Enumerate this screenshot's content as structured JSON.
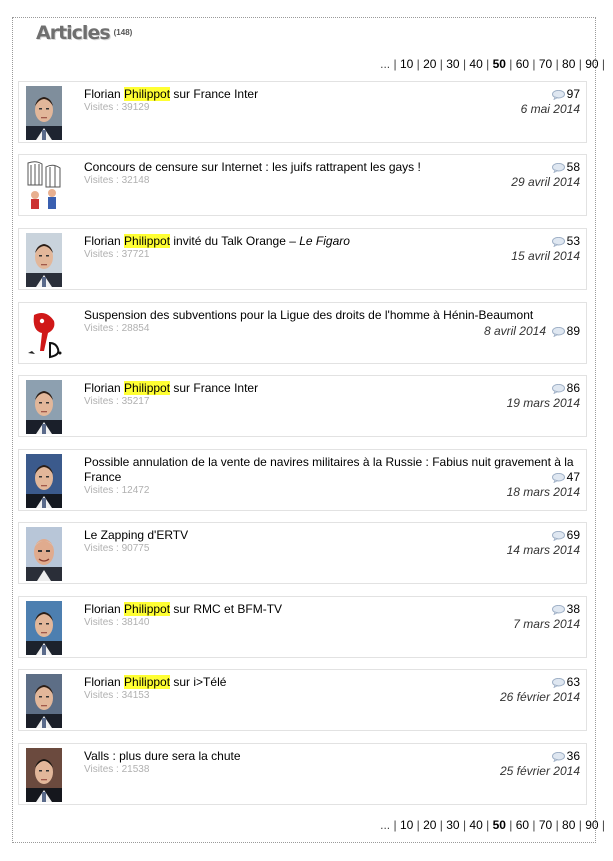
{
  "header": {
    "title": "Articles",
    "count": "(148)"
  },
  "pagination": {
    "prefix": "... |",
    "pages": [
      "10",
      "20",
      "30",
      "40",
      "50",
      "60",
      "70",
      "80",
      "90"
    ],
    "current": "50",
    "suffix": "|"
  },
  "articles": [
    {
      "pre": "Florian ",
      "hl": "Philippot",
      "post": " sur France Inter",
      "ital": "",
      "visits": "Visites : 39129",
      "comments": "97",
      "date": "6 mai 2014"
    },
    {
      "pre": "Concours de censure sur Internet : les juifs rattrapent les gays !",
      "hl": "",
      "post": "",
      "ital": "",
      "visits": "Visites : 32148",
      "comments": "58",
      "date": "29 avril 2014"
    },
    {
      "pre": "Florian ",
      "hl": "Philippot",
      "post": " invité du Talk Orange – ",
      "ital": "Le Figaro",
      "visits": "Visites : 37721",
      "comments": "53",
      "date": "15 avril 2014"
    },
    {
      "pre": "Suspension des subventions pour la Ligue des droits de l'homme à Hénin-Beaumont",
      "hl": "",
      "post": "",
      "ital": "",
      "visits": "Visites : 28854",
      "comments": "89",
      "date": "8 avril 2014"
    },
    {
      "pre": "Florian ",
      "hl": "Philippot",
      "post": " sur France Inter",
      "ital": "",
      "visits": "Visites : 35217",
      "comments": "86",
      "date": "19 mars 2014"
    },
    {
      "pre": "Possible annulation de la vente de navires militaires à la Russie : Fabius nuit gravement à la France",
      "hl": "",
      "post": "",
      "ital": "",
      "visits": "Visites : 12472",
      "comments": "47",
      "date": "18 mars 2014"
    },
    {
      "pre": "Le Zapping d'ERTV",
      "hl": "",
      "post": "",
      "ital": "",
      "visits": "Visites : 90775",
      "comments": "69",
      "date": "14 mars 2014"
    },
    {
      "pre": "Florian ",
      "hl": "Philippot",
      "post": " sur RMC et BFM-TV",
      "ital": "",
      "visits": "Visites : 38140",
      "comments": "38",
      "date": "7 mars 2014"
    },
    {
      "pre": "Florian ",
      "hl": "Philippot",
      "post": " sur i>Télé",
      "ital": "",
      "visits": "Visites : 34153",
      "comments": "63",
      "date": "26 février 2014"
    },
    {
      "pre": "Valls : plus dure sera la chute",
      "hl": "",
      "post": "",
      "ital": "",
      "visits": "Visites : 21538",
      "comments": "36",
      "date": "25 février 2014"
    }
  ],
  "colors": {
    "highlight": "#ffff33",
    "visits_text": "#b0b0b0",
    "card_border": "#e2e2e2",
    "title_grey": "#6f6f6f"
  }
}
